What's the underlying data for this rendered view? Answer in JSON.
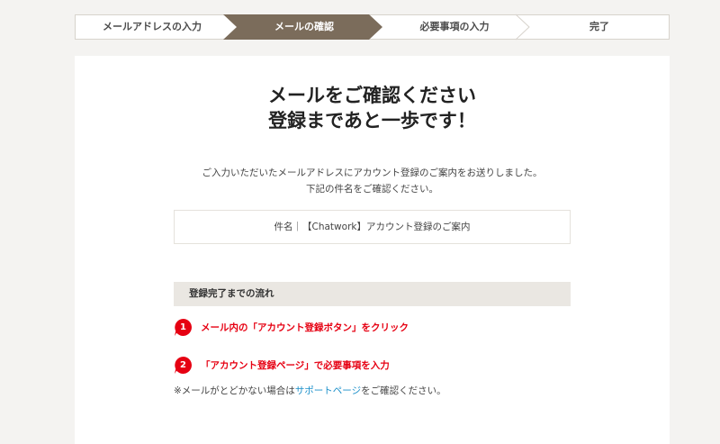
{
  "steps": [
    {
      "label": "メールアドレスの入力",
      "active": false
    },
    {
      "label": "メールの確認",
      "active": true
    },
    {
      "label": "必要事項の入力",
      "active": false
    },
    {
      "label": "完了",
      "active": false
    }
  ],
  "heading": {
    "line1": "メールをご確認ください",
    "line2": "登録まであと一歩です！"
  },
  "description": {
    "line1": "ご入力いただいたメールアドレスにアカウント登録のご案内をお送りしました。",
    "line2": "下記の件名をご確認ください。"
  },
  "subject": {
    "text": "件名｜【Chatwork】アカウント登録のご案内"
  },
  "flow": {
    "title": "登録完了までの流れ",
    "steps": [
      {
        "number": "1",
        "text": "メール内の「アカウント登録ボタン」をクリック"
      },
      {
        "number": "2",
        "text": "「アカウント登録ページ」で必要事項を入力"
      }
    ]
  },
  "note": {
    "prefix": "※メールがとどかない場合は",
    "link": "サポートページ",
    "suffix": "をご確認ください。"
  },
  "colors": {
    "step_active": "#7b6c5b",
    "step_border": "#d7d3cc",
    "accent_red": "#e60012",
    "link": "#1a8fc9"
  }
}
